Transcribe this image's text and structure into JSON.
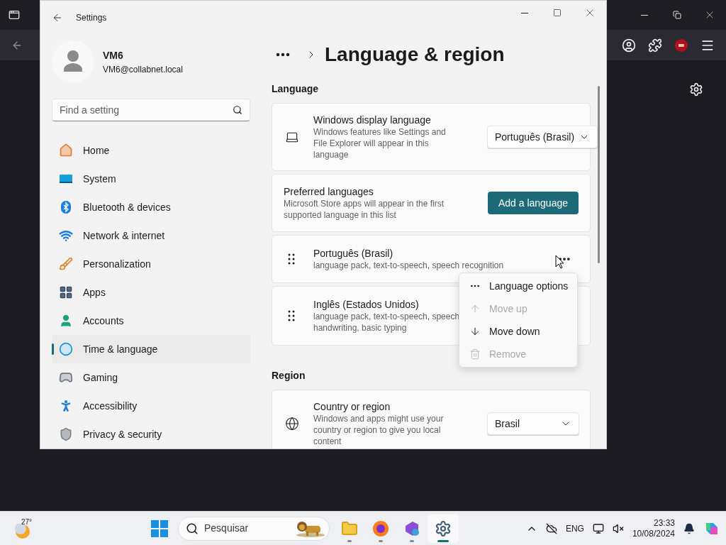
{
  "window": {
    "title": "Settings"
  },
  "profile": {
    "name": "VM6",
    "email": "VM6@collabnet.local"
  },
  "search": {
    "placeholder": "Find a setting"
  },
  "sidebar": {
    "items": [
      {
        "label": "Home",
        "kind": "home",
        "selected": false
      },
      {
        "label": "System",
        "kind": "system",
        "selected": false
      },
      {
        "label": "Bluetooth & devices",
        "kind": "bluetooth",
        "selected": false
      },
      {
        "label": "Network & internet",
        "kind": "network",
        "selected": false
      },
      {
        "label": "Personalization",
        "kind": "brush",
        "selected": false
      },
      {
        "label": "Apps",
        "kind": "apps",
        "selected": false
      },
      {
        "label": "Accounts",
        "kind": "accounts",
        "selected": false
      },
      {
        "label": "Time & language",
        "kind": "time",
        "selected": true
      },
      {
        "label": "Gaming",
        "kind": "gaming",
        "selected": false
      },
      {
        "label": "Accessibility",
        "kind": "accessibility",
        "selected": false
      },
      {
        "label": "Privacy & security",
        "kind": "privacy",
        "selected": false
      }
    ]
  },
  "page_title": "Language & region",
  "sections": [
    {
      "heading": "Language",
      "cards": [
        {
          "kind": "display",
          "title": "Windows display language",
          "description": "Windows features like Settings and File Explorer will appear in this language",
          "value": "Português (Brasil)"
        },
        {
          "kind": "action",
          "title": "Preferred languages",
          "description": "Microsoft Store apps will appear in the first supported language in this list",
          "button": "Add a language"
        },
        {
          "kind": "language",
          "title": "Português (Brasil)",
          "description_lines": [
            "language pack, text-to-speech, speech recognition"
          ],
          "more_button": true
        },
        {
          "kind": "language",
          "title": "Inglês (Estados Unidos)",
          "description_lines": [
            "language pack, text-to-speech, speech",
            "handwriting, basic typing"
          ]
        }
      ]
    },
    {
      "heading": "Region",
      "cards": [
        {
          "kind": "region",
          "title": "Country or region",
          "description": "Windows and apps might use your country or region to give you local content",
          "value": "Brasil"
        }
      ]
    }
  ],
  "context_menu": {
    "items": [
      {
        "label": "Language options",
        "kind": "more",
        "disabled": false
      },
      {
        "label": "Move up",
        "kind": "up",
        "disabled": true
      },
      {
        "label": "Move down",
        "kind": "down",
        "disabled": false
      },
      {
        "label": "Remove",
        "kind": "remove",
        "disabled": true
      }
    ]
  },
  "taskbar": {
    "weather": "27°",
    "search_placeholder": "Pesquisar",
    "apps": [
      {
        "kind": "files",
        "selected": false
      },
      {
        "kind": "browser",
        "selected": false
      },
      {
        "kind": "studio",
        "selected": false
      },
      {
        "kind": "settings",
        "selected": true
      }
    ],
    "language": "ENG",
    "time": "23:33",
    "date": "10/08/2024"
  }
}
